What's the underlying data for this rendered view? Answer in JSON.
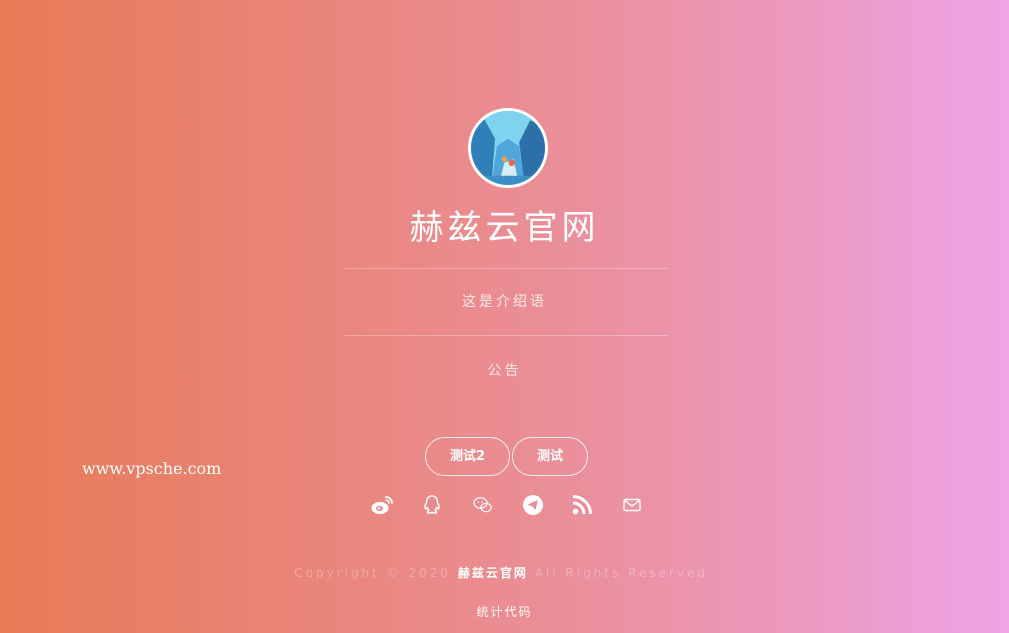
{
  "profile": {
    "title": "赫兹云官网",
    "intro": "这是介绍语",
    "notice": "公告"
  },
  "watermark": "www.vpsche.com",
  "buttons": [
    {
      "label": "测试2"
    },
    {
      "label": "测试"
    }
  ],
  "social_icons": [
    "weibo-icon",
    "qq-icon",
    "wechat-icon",
    "telegram-icon",
    "rss-icon",
    "email-icon"
  ],
  "footer": {
    "copyright_prefix": "Copyright © 2020",
    "brand": "赫兹云官网",
    "copyright_suffix": "All Rights Reserved.",
    "stats": "统计代码"
  },
  "colors": {
    "gradient_start": "#e87a56",
    "gradient_end": "#eea4e6",
    "text": "#ffffff"
  }
}
